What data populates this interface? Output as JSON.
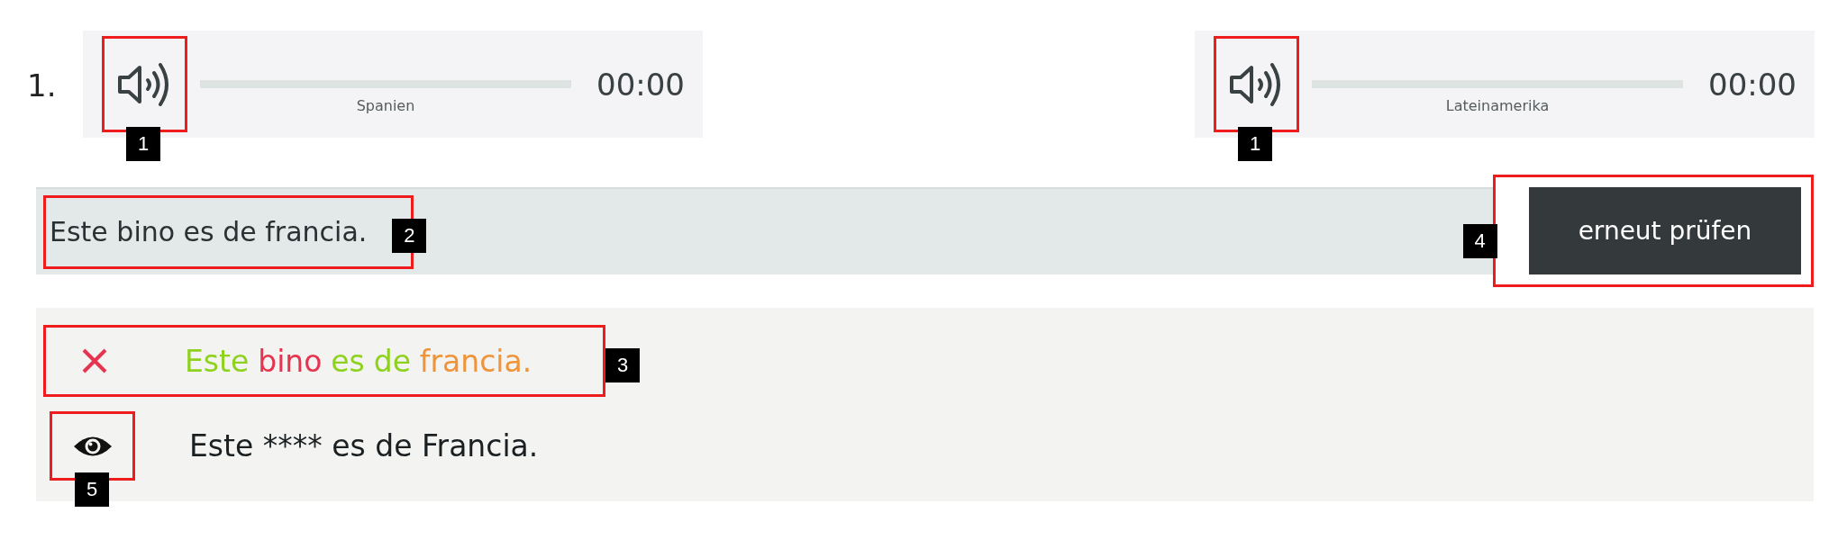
{
  "item_number": "1.",
  "players": [
    {
      "label": "Spanien",
      "time": "00:00",
      "level": 0,
      "callout": "1"
    },
    {
      "label": "Lateinamerika",
      "time": "00:00",
      "level": 0,
      "callout": "1"
    }
  ],
  "answer": {
    "value": "Este bino es de francia.",
    "callout": "2"
  },
  "check_button": {
    "label": "erneut prüfen",
    "callout": "4"
  },
  "result": {
    "callout": "3",
    "correct": false,
    "words": [
      {
        "text": "Este",
        "color": "#8fd21e"
      },
      {
        "text": "bino",
        "color": "#e5344f"
      },
      {
        "text": "es",
        "color": "#8fd21e"
      },
      {
        "text": "de",
        "color": "#8fd21e"
      },
      {
        "text": "francia.",
        "color": "#f0943a"
      }
    ]
  },
  "solution": {
    "text": "Este **** es de Francia.",
    "callout": "5"
  }
}
